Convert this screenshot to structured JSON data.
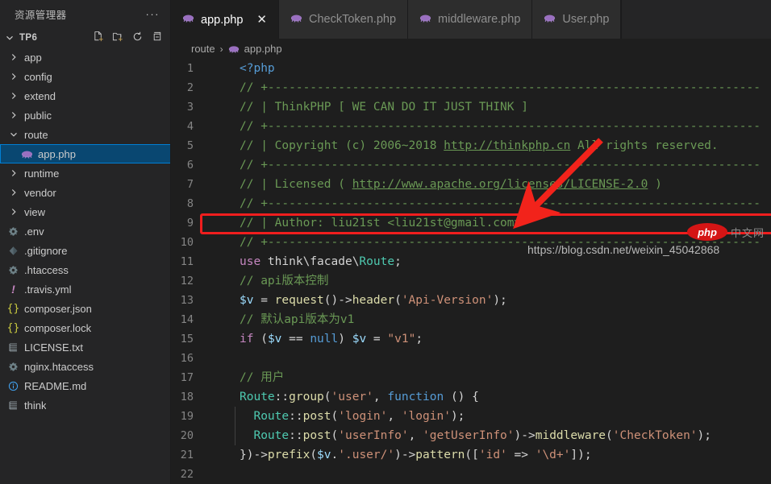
{
  "sidebar": {
    "title": "资源管理器",
    "more_label": "···",
    "section": {
      "name": "TP6",
      "expanded": true,
      "actions": [
        "new-file-icon",
        "new-folder-icon",
        "refresh-icon",
        "collapse-all-icon"
      ]
    },
    "items": [
      {
        "label": "app",
        "type": "folder",
        "expanded": false,
        "depth": 1,
        "icon": "chevron-right-icon",
        "selected": false
      },
      {
        "label": "config",
        "type": "folder",
        "expanded": false,
        "depth": 1,
        "icon": "chevron-right-icon",
        "selected": false
      },
      {
        "label": "extend",
        "type": "folder",
        "expanded": false,
        "depth": 1,
        "icon": "chevron-right-icon",
        "selected": false
      },
      {
        "label": "public",
        "type": "folder",
        "expanded": false,
        "depth": 1,
        "icon": "chevron-right-icon",
        "selected": false
      },
      {
        "label": "route",
        "type": "folder",
        "expanded": true,
        "depth": 1,
        "icon": "chevron-down-icon",
        "selected": false
      },
      {
        "label": "app.php",
        "type": "file",
        "depth": 2,
        "icon": "php-file-icon",
        "selected": true
      },
      {
        "label": "runtime",
        "type": "folder",
        "expanded": false,
        "depth": 1,
        "icon": "chevron-right-icon",
        "selected": false
      },
      {
        "label": "vendor",
        "type": "folder",
        "expanded": false,
        "depth": 1,
        "icon": "chevron-right-icon",
        "selected": false
      },
      {
        "label": "view",
        "type": "folder",
        "expanded": false,
        "depth": 1,
        "icon": "chevron-right-icon",
        "selected": false
      },
      {
        "label": ".env",
        "type": "file",
        "depth": 1,
        "icon": "gear-icon",
        "selected": false
      },
      {
        "label": ".gitignore",
        "type": "file",
        "depth": 1,
        "icon": "git-icon",
        "selected": false
      },
      {
        "label": ".htaccess",
        "type": "file",
        "depth": 1,
        "icon": "gear-icon",
        "selected": false
      },
      {
        "label": ".travis.yml",
        "type": "file",
        "depth": 1,
        "icon": "yaml-icon",
        "selected": false
      },
      {
        "label": "composer.json",
        "type": "file",
        "depth": 1,
        "icon": "json-icon",
        "selected": false
      },
      {
        "label": "composer.lock",
        "type": "file",
        "depth": 1,
        "icon": "json-icon",
        "selected": false
      },
      {
        "label": "LICENSE.txt",
        "type": "file",
        "depth": 1,
        "icon": "text-file-icon",
        "selected": false
      },
      {
        "label": "nginx.htaccess",
        "type": "file",
        "depth": 1,
        "icon": "gear-icon",
        "selected": false
      },
      {
        "label": "README.md",
        "type": "file",
        "depth": 1,
        "icon": "info-icon",
        "selected": false
      },
      {
        "label": "think",
        "type": "file",
        "depth": 1,
        "icon": "text-file-icon",
        "selected": false
      }
    ]
  },
  "tabs": [
    {
      "label": "app.php",
      "icon": "php-file-icon",
      "active": true,
      "closable": true,
      "close_label": "✕"
    },
    {
      "label": "CheckToken.php",
      "icon": "php-file-icon",
      "active": false,
      "closable": false
    },
    {
      "label": "middleware.php",
      "icon": "php-file-icon",
      "active": false,
      "closable": false
    },
    {
      "label": "User.php",
      "icon": "php-file-icon",
      "active": false,
      "closable": false
    }
  ],
  "breadcrumb": {
    "folder": "route",
    "separator": "›",
    "file": "app.php",
    "file_icon": "php-file-icon"
  },
  "code": {
    "lines": [
      {
        "n": "1",
        "tokens": [
          {
            "t": "<?php",
            "c": "c-kw"
          }
        ]
      },
      {
        "n": "2",
        "tokens": [
          {
            "t": "// +----------------------------------------------------------------------",
            "c": "c-com"
          }
        ]
      },
      {
        "n": "3",
        "tokens": [
          {
            "t": "// | ThinkPHP [ WE CAN DO IT JUST THINK ]",
            "c": "c-com"
          }
        ]
      },
      {
        "n": "4",
        "tokens": [
          {
            "t": "// +----------------------------------------------------------------------",
            "c": "c-com"
          }
        ]
      },
      {
        "n": "5",
        "tokens": [
          {
            "t": "// | Copyright (c) 2006~2018 ",
            "c": "c-com"
          },
          {
            "t": "http://thinkphp.cn",
            "c": "c-link"
          },
          {
            "t": " All rights reserved.",
            "c": "c-com"
          }
        ]
      },
      {
        "n": "6",
        "tokens": [
          {
            "t": "// +----------------------------------------------------------------------",
            "c": "c-com"
          }
        ]
      },
      {
        "n": "7",
        "tokens": [
          {
            "t": "// | Licensed ( ",
            "c": "c-com"
          },
          {
            "t": "http://www.apache.org/licenses/LICENSE-2.0",
            "c": "c-link"
          },
          {
            "t": " )",
            "c": "c-com"
          }
        ]
      },
      {
        "n": "8",
        "tokens": [
          {
            "t": "// +----------------------------------------------------------------------",
            "c": "c-com"
          }
        ]
      },
      {
        "n": "9",
        "tokens": [
          {
            "t": "// | Author: liu21st <liu21st@gmail.com>",
            "c": "c-com"
          }
        ]
      },
      {
        "n": "10",
        "tokens": [
          {
            "t": "// +----------------------------------------------------------------------",
            "c": "c-com"
          }
        ]
      },
      {
        "n": "11",
        "tokens": [
          {
            "t": "use",
            "c": "c-kw2"
          },
          {
            "t": " think\\facade\\",
            "c": "c-pl"
          },
          {
            "t": "Route",
            "c": "c-cls"
          },
          {
            "t": ";",
            "c": "c-pl"
          }
        ]
      },
      {
        "n": "12",
        "tokens": [
          {
            "t": "// api版本控制",
            "c": "c-com"
          }
        ]
      },
      {
        "n": "13",
        "tokens": [
          {
            "t": "$v",
            "c": "c-var"
          },
          {
            "t": " = ",
            "c": "c-pl"
          },
          {
            "t": "request",
            "c": "c-fn"
          },
          {
            "t": "()->",
            "c": "c-pl"
          },
          {
            "t": "header",
            "c": "c-fn"
          },
          {
            "t": "(",
            "c": "c-pl"
          },
          {
            "t": "'Api-Version'",
            "c": "c-str"
          },
          {
            "t": ");",
            "c": "c-pl"
          }
        ]
      },
      {
        "n": "14",
        "tokens": [
          {
            "t": "// 默认api版本为v1",
            "c": "c-com"
          }
        ]
      },
      {
        "n": "15",
        "tokens": [
          {
            "t": "if",
            "c": "c-kw2"
          },
          {
            "t": " (",
            "c": "c-pl"
          },
          {
            "t": "$v",
            "c": "c-var"
          },
          {
            "t": " == ",
            "c": "c-pl"
          },
          {
            "t": "null",
            "c": "c-kw"
          },
          {
            "t": ") ",
            "c": "c-pl"
          },
          {
            "t": "$v",
            "c": "c-var"
          },
          {
            "t": " = ",
            "c": "c-pl"
          },
          {
            "t": "\"v1\"",
            "c": "c-str"
          },
          {
            "t": ";",
            "c": "c-pl"
          }
        ]
      },
      {
        "n": "16",
        "tokens": [
          {
            "t": "",
            "c": "c-pl"
          }
        ]
      },
      {
        "n": "17",
        "tokens": [
          {
            "t": "// 用户",
            "c": "c-com"
          }
        ]
      },
      {
        "n": "18",
        "tokens": [
          {
            "t": "Route",
            "c": "c-cls"
          },
          {
            "t": "::",
            "c": "c-pl"
          },
          {
            "t": "group",
            "c": "c-fn"
          },
          {
            "t": "(",
            "c": "c-pl"
          },
          {
            "t": "'user'",
            "c": "c-str"
          },
          {
            "t": ", ",
            "c": "c-pl"
          },
          {
            "t": "function",
            "c": "c-kw"
          },
          {
            "t": " () {",
            "c": "c-pl"
          }
        ]
      },
      {
        "n": "19",
        "guide": true,
        "tokens": [
          {
            "t": "  ",
            "c": "c-pl"
          },
          {
            "t": "Route",
            "c": "c-cls"
          },
          {
            "t": "::",
            "c": "c-pl"
          },
          {
            "t": "post",
            "c": "c-fn"
          },
          {
            "t": "(",
            "c": "c-pl"
          },
          {
            "t": "'login'",
            "c": "c-str"
          },
          {
            "t": ", ",
            "c": "c-pl"
          },
          {
            "t": "'login'",
            "c": "c-str"
          },
          {
            "t": ");",
            "c": "c-pl"
          }
        ]
      },
      {
        "n": "20",
        "guide": true,
        "tokens": [
          {
            "t": "  ",
            "c": "c-pl"
          },
          {
            "t": "Route",
            "c": "c-cls"
          },
          {
            "t": "::",
            "c": "c-pl"
          },
          {
            "t": "post",
            "c": "c-fn"
          },
          {
            "t": "(",
            "c": "c-pl"
          },
          {
            "t": "'userInfo'",
            "c": "c-str"
          },
          {
            "t": ", ",
            "c": "c-pl"
          },
          {
            "t": "'getUserInfo'",
            "c": "c-str"
          },
          {
            "t": ")->",
            "c": "c-pl"
          },
          {
            "t": "middleware",
            "c": "c-fn"
          },
          {
            "t": "(",
            "c": "c-pl"
          },
          {
            "t": "'CheckToken'",
            "c": "c-str"
          },
          {
            "t": ");",
            "c": "c-pl"
          }
        ]
      },
      {
        "n": "21",
        "tokens": [
          {
            "t": "})->",
            "c": "c-pl"
          },
          {
            "t": "prefix",
            "c": "c-fn"
          },
          {
            "t": "(",
            "c": "c-pl"
          },
          {
            "t": "$v",
            "c": "c-var"
          },
          {
            "t": ".",
            "c": "c-pl"
          },
          {
            "t": "'.user/'",
            "c": "c-str"
          },
          {
            "t": ")->",
            "c": "c-pl"
          },
          {
            "t": "pattern",
            "c": "c-fn"
          },
          {
            "t": "([",
            "c": "c-pl"
          },
          {
            "t": "'id'",
            "c": "c-str"
          },
          {
            "t": " => ",
            "c": "c-pl"
          },
          {
            "t": "'\\d+'",
            "c": "c-str"
          },
          {
            "t": "]);",
            "c": "c-pl"
          }
        ]
      },
      {
        "n": "22",
        "guide": true,
        "tokens": [
          {
            "t": "",
            "c": "c-pl"
          }
        ]
      }
    ]
  },
  "annotations": {
    "highlight_box_color": "#f01e1e",
    "arrow_color": "#f2231b",
    "arrow_label": "pointer-arrow",
    "highlight_label": "highlighted-code-line"
  },
  "watermark": {
    "url": "https://blog.csdn.net/weixin_45042868",
    "logo_text": "php",
    "logo_cn": "中文网"
  }
}
